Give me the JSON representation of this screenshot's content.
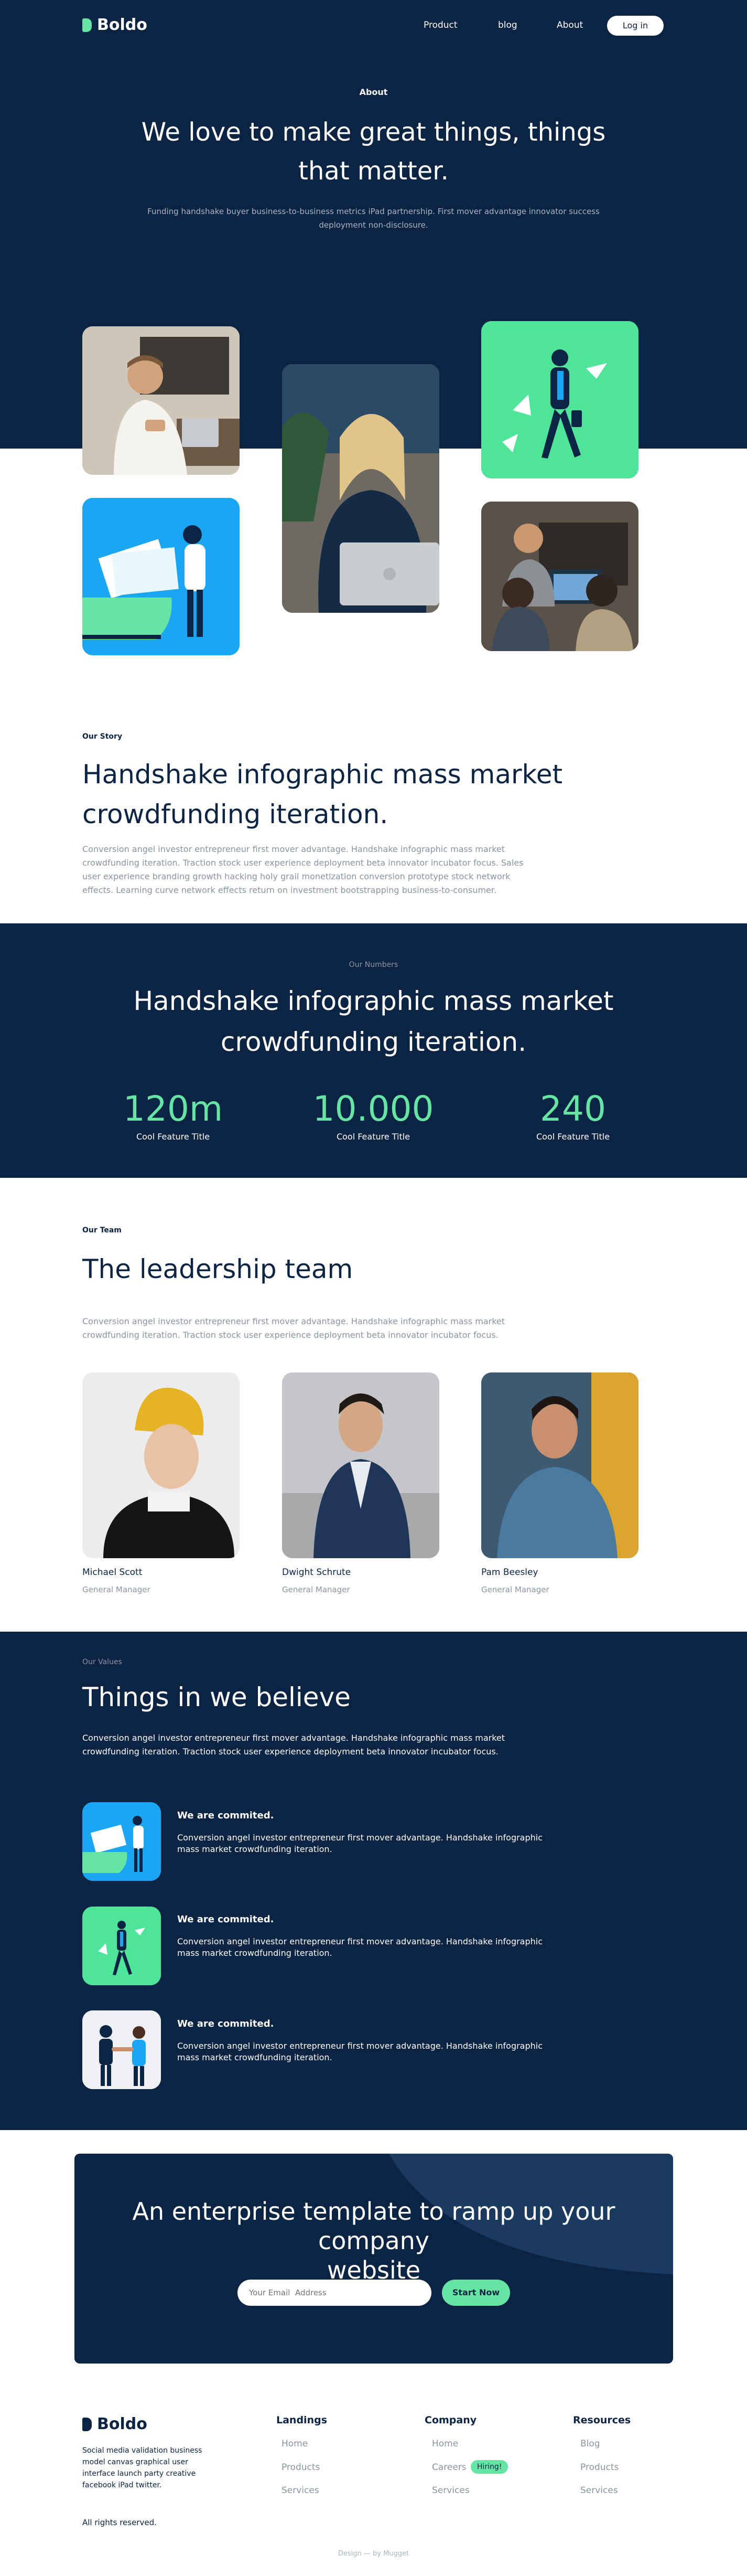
{
  "brand": {
    "name": "Boldo"
  },
  "nav": {
    "items": [
      "Product",
      "blog",
      "About"
    ],
    "login": "Log in"
  },
  "hero": {
    "eyebrow": "About",
    "title_line1": "We love to make great things, things",
    "title_line2": "that matter.",
    "subtitle_line1": "Funding handshake buyer business-to-business metrics iPad partnership. First mover advantage innovator success",
    "subtitle_line2": "deployment non-disclosure."
  },
  "story": {
    "eyebrow": "Our Story",
    "title_line1": "Handshake infographic mass market",
    "title_line2": "crowdfunding iteration.",
    "text": "Conversion angel investor entrepreneur first mover advantage. Handshake infographic mass market crowdfunding iteration. Traction stock user experience deployment beta innovator incubator focus. Sales user experience branding growth hacking holy grail monetization conversion prototype stock network effects. Learning curve network effects return on investment bootstrapping business-to-consumer."
  },
  "numbers": {
    "eyebrow": "Our Numbers",
    "title_line1": "Handshake infographic mass market",
    "title_line2": "crowdfunding iteration.",
    "stats": [
      {
        "value": "120m",
        "label": "Cool Feature Title"
      },
      {
        "value": "10.000",
        "label": "Cool Feature Title"
      },
      {
        "value": "240",
        "label": "Cool Feature Title"
      }
    ]
  },
  "team": {
    "eyebrow": "Our Team",
    "title": "The leadership team",
    "text": "Conversion angel investor entrepreneur first mover advantage. Handshake infographic mass market crowdfunding iteration. Traction stock user experience deployment beta innovator incubator focus.",
    "members": [
      {
        "name": "Michael Scott",
        "role": "General Manager"
      },
      {
        "name": "Dwight Schrute",
        "role": "General Manager"
      },
      {
        "name": "Pam Beesley",
        "role": "General Manager"
      }
    ]
  },
  "values": {
    "eyebrow": "Our Values",
    "title": "Things in we believe",
    "text": "Conversion angel investor entrepreneur first mover advantage. Handshake infographic mass market crowdfunding iteration. Traction stock user experience deployment beta innovator incubator focus.",
    "items": [
      {
        "title": "We are commited.",
        "text": "Conversion angel investor entrepreneur first mover advantage. Handshake infographic mass market crowdfunding iteration."
      },
      {
        "title": "We are commited.",
        "text": "Conversion angel investor entrepreneur first mover advantage. Handshake infographic mass market crowdfunding iteration."
      },
      {
        "title": "We are commited.",
        "text": "Conversion angel investor entrepreneur first mover advantage. Handshake infographic mass market crowdfunding iteration."
      }
    ]
  },
  "cta": {
    "title_line1": "An enterprise template to ramp up your company",
    "title_line2": "website",
    "email_placeholder": "Your Email  Address",
    "button": "Start Now"
  },
  "footer": {
    "brand_text": "Social media validation business model canvas graphical user interface launch party creative facebook iPad twitter.",
    "rights": "All rights reserved.",
    "credit": "Design — by Mugget",
    "columns": [
      {
        "title": "Landings",
        "links": [
          "Home",
          "Products",
          "Services"
        ]
      },
      {
        "title": "Company",
        "links": [
          "Home",
          "Careers",
          "Services"
        ]
      },
      {
        "title": "Resources",
        "links": [
          "Blog",
          "Products",
          "Services"
        ]
      }
    ],
    "hiring_badge": "Hiring!"
  },
  "colors": {
    "navy": "#0b2444",
    "accent": "#65e4a3",
    "blue": "#1aa6f2"
  }
}
